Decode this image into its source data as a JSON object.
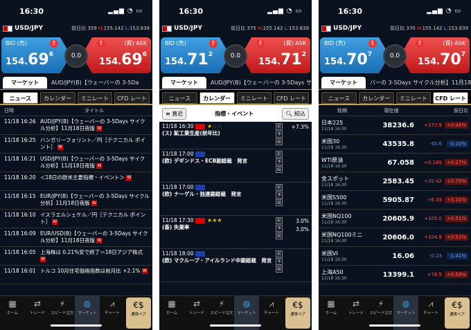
{
  "status": {
    "time": "16:30",
    "icons": "▂▄▆ ◔ ▭"
  },
  "pair": {
    "name": "USD/JPY",
    "prev_label": "前日比",
    "H_label": "H:",
    "L_label": "L:"
  },
  "phones": [
    {
      "prev": "359",
      "high": "155.142",
      "low": "153.839",
      "bid": {
        "label": "BID (売)",
        "pre": "154.",
        "big": "69",
        "sup": "6"
      },
      "ask": {
        "label": "(買) ASK",
        "pre": "154.",
        "big": "69",
        "sup": "6"
      },
      "spread": "0.0",
      "marquee": "AUD/JPY(B)【ウェーバーの 3-5Da"
    },
    {
      "prev": "375",
      "high": "155.142",
      "low": "153.839",
      "bid": {
        "label": "BID (売)",
        "pre": "154.",
        "big": "71",
        "sup": "2"
      },
      "ask": {
        "label": "(買) ASK",
        "pre": "154.",
        "big": "71",
        "sup": "2"
      },
      "spread": "0.0",
      "marquee": "AUD/JPY(B)【ウェーバーの 3-5Days サイ"
    },
    {
      "prev": "370",
      "high": "155.142",
      "low": "153.839",
      "bid": {
        "label": "BID (売)",
        "pre": "154.",
        "big": "70",
        "sup": "7"
      },
      "ask": {
        "label": "(買) ASK",
        "pre": "154.",
        "big": "70",
        "sup": "7"
      },
      "spread": "0.0",
      "marquee": "バーの 3-5Days サイクル分析】11月18日"
    }
  ],
  "tab_main": "マーケット",
  "subtabs": [
    "ニュース",
    "カレンダー",
    "ミニレート",
    "CFD レート"
  ],
  "news": {
    "col_time": "日時",
    "col_title": "タイトル",
    "rows": [
      {
        "time": "11/18 16:26",
        "title": "AUD/JPY(B)【ウェーバーの 3-5Days サイクル分析】11月18日夜版",
        "w": true
      },
      {
        "time": "11/18 16:25",
        "title": "ハンガリーフォリント／円［テクニカル ポイント］",
        "w": true
      },
      {
        "time": "11/18 16:21",
        "title": "USD/JPY(B)【ウェーバーの 3-5Days サイクル分析】11月18日夜版",
        "w": true
      },
      {
        "time": "11/18 16:20",
        "title": "＜18日の欧米主要指標・イベント＞",
        "w": true
      },
      {
        "time": "11/18 16:15",
        "title": "EUR/JPY(B)【ウェーバーの 3-5Days サイクル分析】11月18日夜版",
        "w": true
      },
      {
        "time": "11/18 16:10",
        "title": "イスラエルシェケル／円［テクニカル ポイント］",
        "w": true
      },
      {
        "time": "11/18 16:09",
        "title": "EUR/USD(B)【ウェーバーの 3-5Days サイクル分析】11月18日夜版",
        "w": true
      },
      {
        "time": "11/18 16:05",
        "title": "上海株は 0.21%安で終了＝18日アジア株式",
        "w": true
      },
      {
        "time": "11/18 16:01",
        "title": "トルコ 10月住宅価格指数は前月比 +2.1%",
        "w": true
      }
    ]
  },
  "calendar": {
    "recent": "直近",
    "title": "指標・イベント",
    "filter": "絞込",
    "sides": [
      "前",
      "予",
      "結"
    ],
    "rows": [
      {
        "time": "11/18 16:30",
        "name": "(ス) 鉱工業生産(前年比)",
        "flag": "ch",
        "stars": 1,
        "v1": "+7.3%",
        "v2": "",
        "v3": ""
      },
      {
        "time": "11/18 17:00",
        "name": "(欧) デギンドス・ECB副総裁　発言",
        "flag": "eu",
        "stars": 0,
        "v1": "",
        "v2": "",
        "v3": ""
      },
      {
        "time": "11/18 17:00",
        "name": "(欧) ナーゲル・独連銀総裁　発言",
        "flag": "eu",
        "stars": 0,
        "v1": "",
        "v2": "",
        "v3": ""
      },
      {
        "time": "11/18 17:30",
        "name": "(香) 失業率",
        "flag": "hk",
        "stars": 3,
        "v1": "3.0%",
        "v2": "3.0%",
        "v3": ""
      },
      {
        "time": "11/18 18:00",
        "name": "(欧) マクループ・アイルランド中銀総裁　発言",
        "flag": "eu",
        "stars": 0,
        "v1": "",
        "v2": "",
        "v3": ""
      }
    ]
  },
  "markets": {
    "col_name": "銘柄",
    "col_price": "現在値",
    "col_chg": "前日比",
    "rows": [
      {
        "name": "日本225",
        "time": "11/18 16:30",
        "price": "38236.6",
        "chg": "+170.9",
        "pct": "+0.44%",
        "dir": "up"
      },
      {
        "name": "米国30",
        "time": "11/18 16:30",
        "price": "43535.8",
        "chg": "-45.6",
        "pct": "-0.10%",
        "dir": "down"
      },
      {
        "name": "WTI原油",
        "time": "11/18 16:30",
        "price": "67.058",
        "chg": "+0.185",
        "pct": "+0.27%",
        "dir": "up"
      },
      {
        "name": "金スポット",
        "time": "11/18 16:30",
        "price": "2583.45",
        "chg": "+20.42",
        "pct": "+0.79%",
        "dir": "up"
      },
      {
        "name": "米国S500",
        "time": "11/18 16:30",
        "price": "5905.87",
        "chg": "+6.33",
        "pct": "+0.10%",
        "dir": "up"
      },
      {
        "name": "米国NQ100",
        "time": "11/18 16:30",
        "price": "20605.9",
        "chg": "+105.0",
        "pct": "+0.51%",
        "dir": "up"
      },
      {
        "name": "米国NQ100ミニ",
        "time": "11/18 16:30",
        "price": "20606.0",
        "chg": "+104.9",
        "pct": "+0.51%",
        "dir": "up"
      },
      {
        "name": "米国VI",
        "time": "11/18 16:30",
        "price": "16.06",
        "chg": "-0.23",
        "pct": "-1.41%",
        "dir": "down"
      },
      {
        "name": "上海A50",
        "time": "11/18 16:30",
        "price": "13399.1",
        "chg": "+78.5",
        "pct": "+0.58%",
        "dir": "up"
      }
    ]
  },
  "nav": [
    {
      "label": "ホーム",
      "icon": "home-icon",
      "glyph": "▦"
    },
    {
      "label": "トレード",
      "icon": "trade-icon",
      "glyph": "⇄"
    },
    {
      "label": "スピード注文",
      "icon": "speed-icon",
      "glyph": "⚡"
    },
    {
      "label": "マーケット",
      "icon": "globe-icon",
      "glyph": "◍"
    },
    {
      "label": "チャート",
      "icon": "chart-icon",
      "glyph": "⩘"
    },
    {
      "label": "通貨ペア",
      "icon": "currency-pair-icon",
      "glyph": "€$"
    }
  ]
}
